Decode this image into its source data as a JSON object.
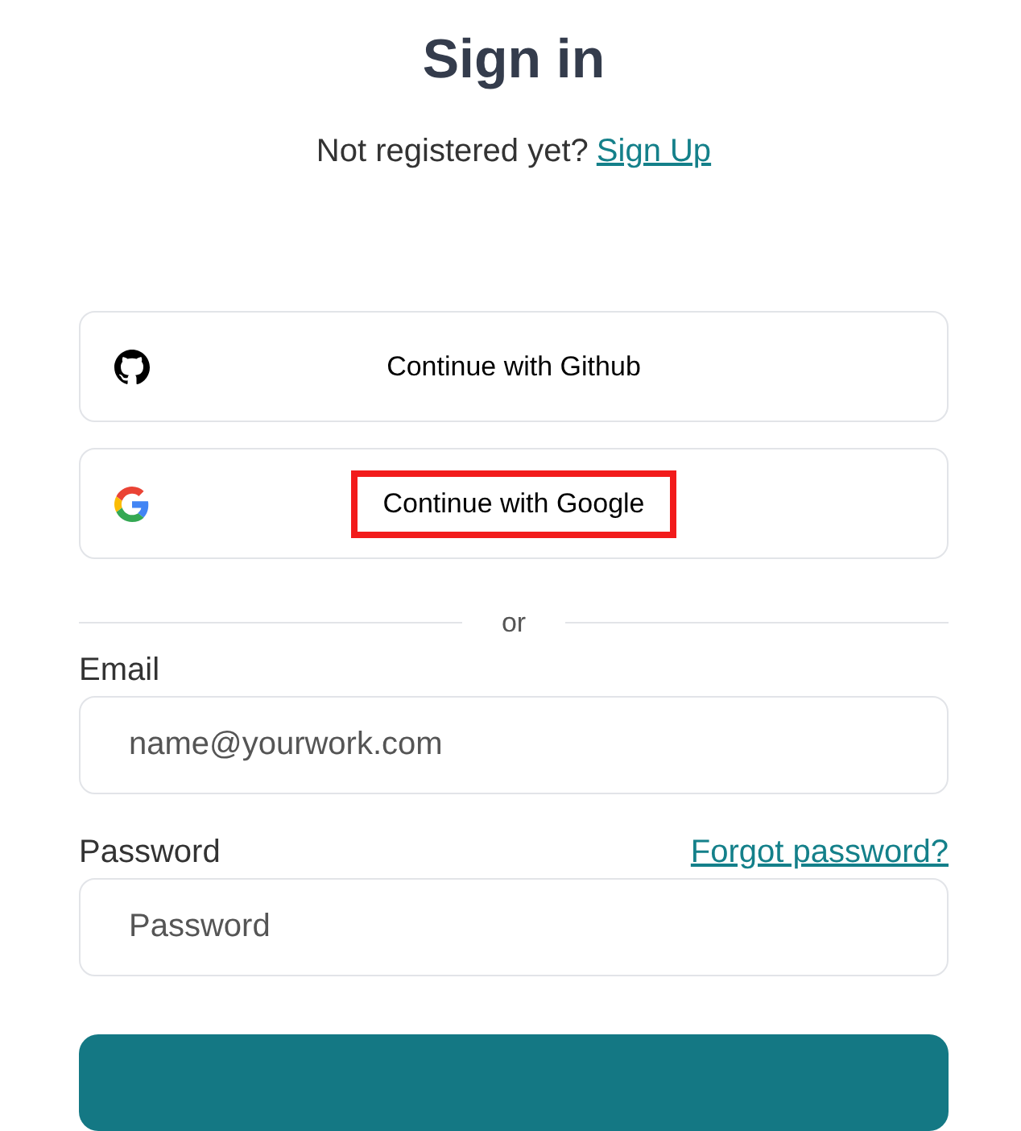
{
  "title": "Sign in",
  "register_prompt": {
    "text": "Not registered yet?",
    "link": "Sign Up"
  },
  "providers": [
    {
      "kind": "github",
      "label": "Continue with Github",
      "highlighted": false
    },
    {
      "kind": "google",
      "label": "Continue with Google",
      "highlighted": true
    }
  ],
  "divider": "or",
  "email": {
    "label": "Email",
    "placeholder": "name@yourwork.com"
  },
  "password": {
    "label": "Password",
    "link": "Forgot password?",
    "placeholder": "Password"
  }
}
